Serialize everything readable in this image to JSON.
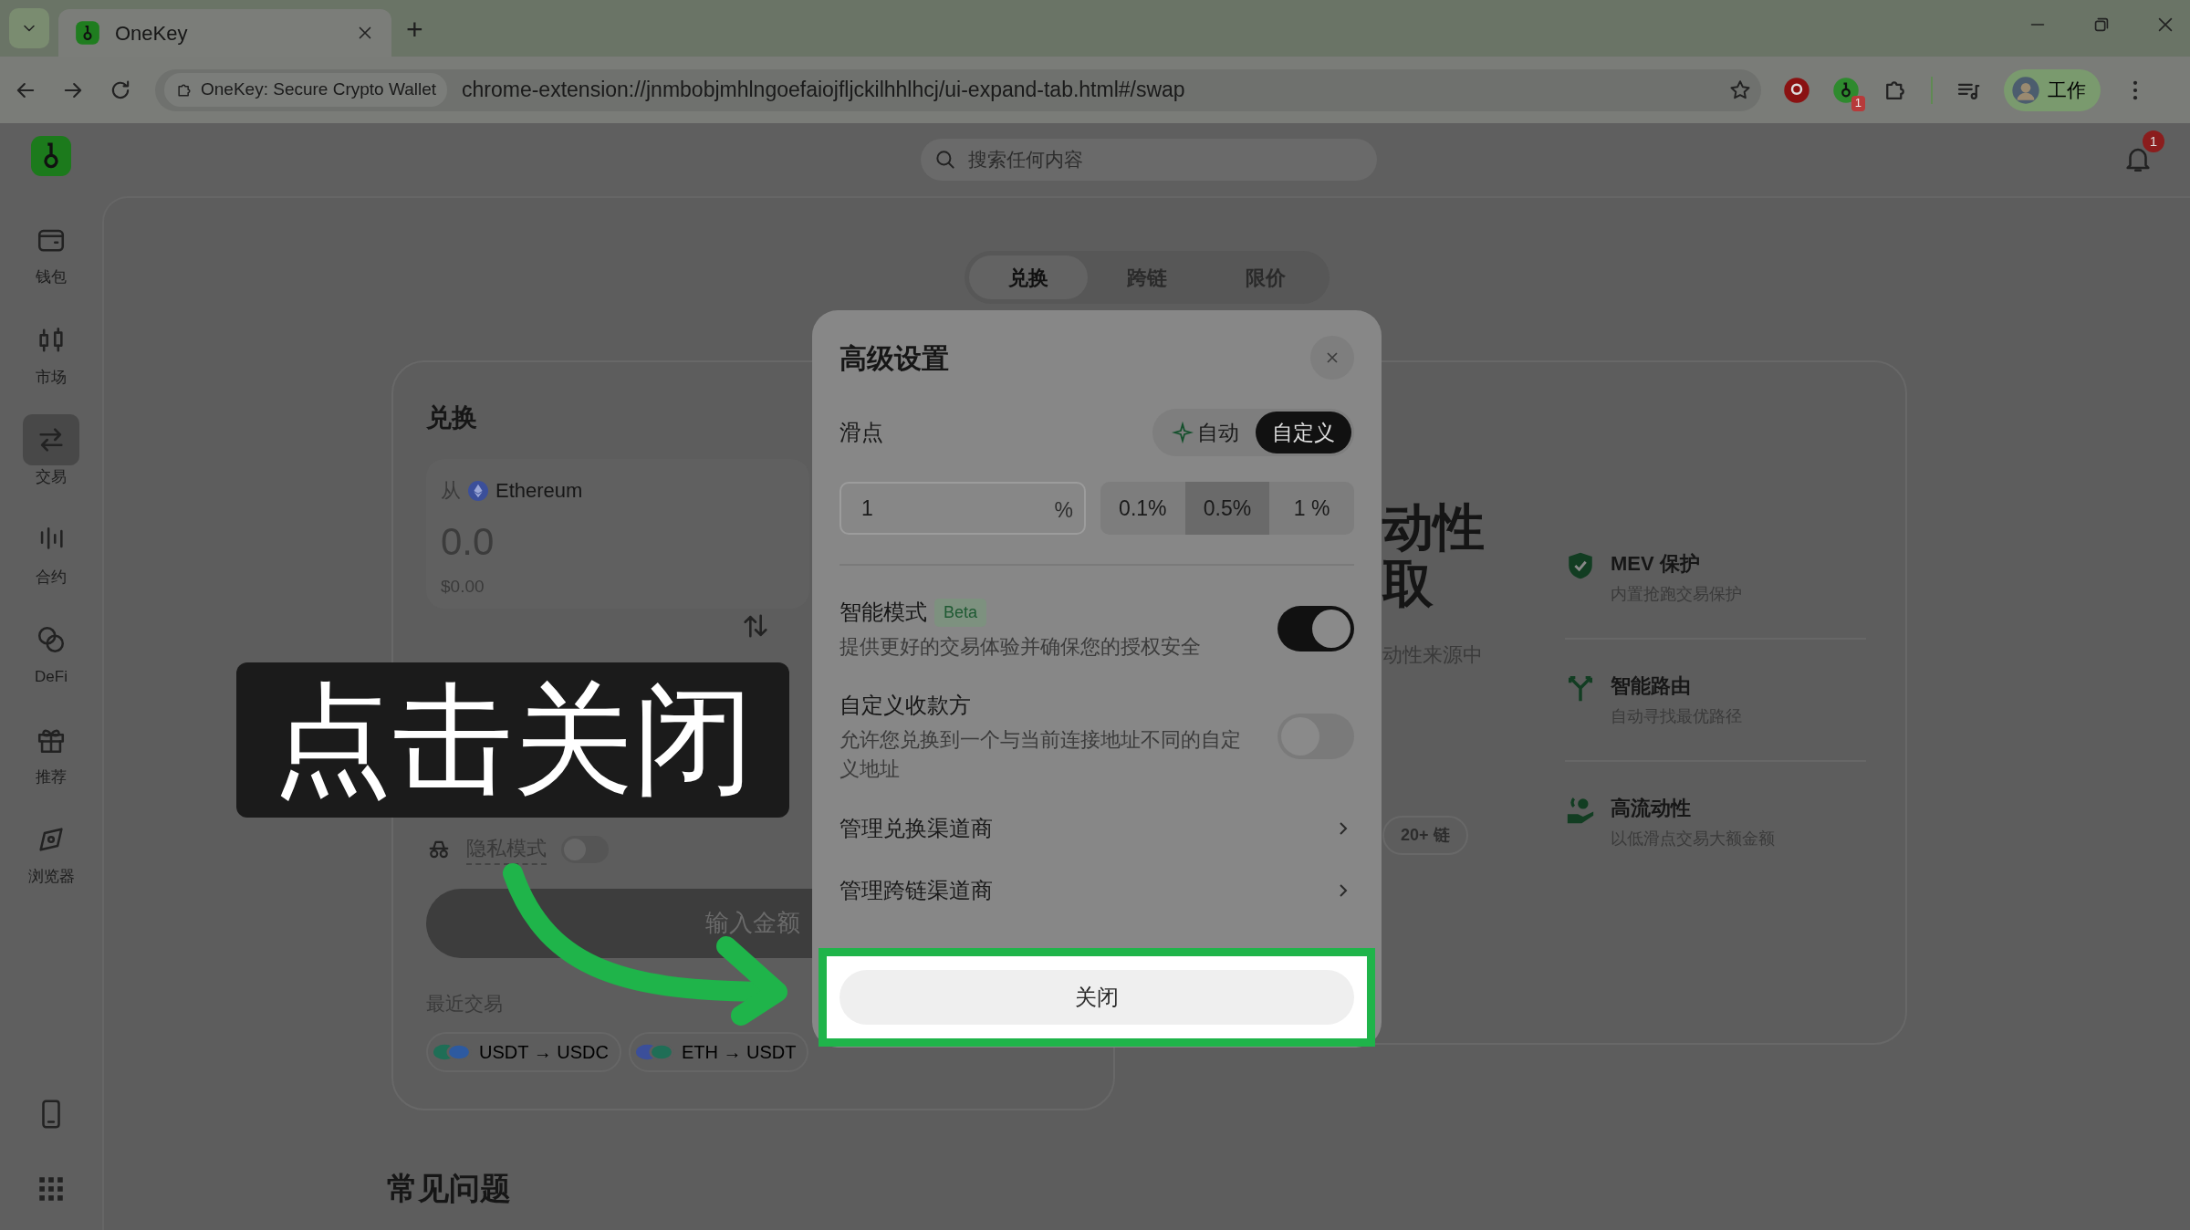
{
  "browser": {
    "tab": {
      "title": "OneKey"
    },
    "new_tab": "+",
    "site_chip": "OneKey: Secure Crypto Wallet",
    "url": "chrome-extension://jnmbobjmhlngoefaiojfljckilhhlhcj/ui-expand-tab.html#/swap",
    "extension_badge": "1",
    "profile": "工作"
  },
  "sidebar": {
    "items": [
      {
        "kind": "wallet",
        "label": "钱包",
        "selected": false
      },
      {
        "kind": "market",
        "label": "市场",
        "selected": false
      },
      {
        "kind": "swap",
        "label": "交易",
        "selected": true
      },
      {
        "kind": "contract",
        "label": "合约",
        "selected": false
      },
      {
        "kind": "defi",
        "label": "DeFi",
        "selected": false
      },
      {
        "kind": "gift",
        "label": "推荐",
        "selected": false
      },
      {
        "kind": "browser",
        "label": "浏览器",
        "selected": false
      }
    ]
  },
  "search": {
    "placeholder": "搜索任何内容"
  },
  "notification_badge": "1",
  "mode_tabs": [
    {
      "label": "兑换",
      "selected": true
    },
    {
      "label": "跨链",
      "selected": false
    },
    {
      "label": "限价",
      "selected": false
    }
  ],
  "swap": {
    "title": "兑换",
    "from": {
      "label": "从",
      "network": "Ethereum",
      "amount": "0.0",
      "value": "$0.00"
    },
    "privacy": {
      "label": "隐私模式",
      "on": false
    },
    "submit": {
      "label": "输入金额",
      "disabled": true
    },
    "recent_title": "最近交易",
    "recent": [
      {
        "label": "USDT → USDC"
      },
      {
        "label": "ETH → USDT"
      }
    ]
  },
  "promo": {
    "headline": [
      "动性",
      "取"
    ],
    "subtitle": "动性来源中",
    "chains": "20+ 链",
    "features": [
      {
        "kind": "shield",
        "title": "MEV 保护",
        "desc": "内置抢跑交易保护"
      },
      {
        "kind": "route",
        "title": "智能路由",
        "desc": "自动寻找最优路径"
      },
      {
        "kind": "liquidity",
        "title": "高流动性",
        "desc": "以低滑点交易大额金额"
      }
    ]
  },
  "faq_title": "常见问题",
  "dialog": {
    "title": "高级设置",
    "slippage": {
      "label": "滑点",
      "modes": [
        {
          "label": "自动",
          "selected": false
        },
        {
          "label": "自定义",
          "selected": true
        }
      ],
      "value": "1",
      "unit": "%",
      "presets": [
        {
          "label": "0.1%",
          "selected": false
        },
        {
          "label": "0.5%",
          "selected": true
        },
        {
          "label": "1 %",
          "selected": false
        }
      ]
    },
    "toggles": [
      {
        "title": "智能模式",
        "badge": "Beta",
        "desc": "提供更好的交易体验并确保您的授权安全",
        "on": true
      },
      {
        "title": "自定义收款方",
        "desc": "允许您兑换到一个与当前连接地址不同的自定义地址",
        "on": false
      }
    ],
    "links": [
      {
        "label": "管理兑换渠道商"
      },
      {
        "label": "管理跨链渠道商"
      }
    ],
    "close_button": "关闭"
  },
  "annotation": {
    "caption": "点击关闭"
  }
}
